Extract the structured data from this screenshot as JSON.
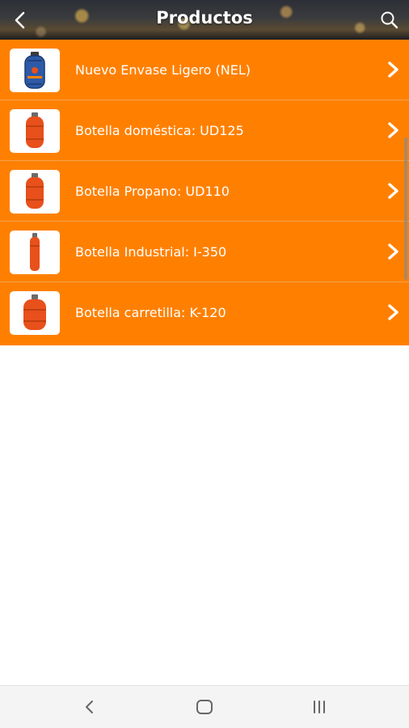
{
  "header": {
    "title": "Productos",
    "back_icon": "chevron-left-icon",
    "search_icon": "search-icon"
  },
  "products": [
    {
      "name": "Nuevo Envase Ligero (NEL)",
      "image": "gas-cylinder-blue-cage",
      "color": "#2d5aa8"
    },
    {
      "name": "Botella doméstica: UD125",
      "image": "gas-cylinder-orange",
      "color": "#e8501c"
    },
    {
      "name": "Botella Propano: UD110",
      "image": "gas-cylinder-orange",
      "color": "#e8501c"
    },
    {
      "name": "Botella Industrial: I-350",
      "image": "gas-cylinder-tall-orange",
      "color": "#e8501c"
    },
    {
      "name": "Botella carretilla: K-120",
      "image": "gas-cylinder-orange-wide",
      "color": "#e8501c"
    }
  ],
  "row_action_icon": "chevron-right-icon",
  "theme": {
    "accent": "#ff8000",
    "text_on_accent": "#ffffff"
  },
  "system_nav": {
    "back_icon": "nav-back-icon",
    "home_icon": "nav-home-icon",
    "recents_icon": "nav-recents-icon"
  }
}
